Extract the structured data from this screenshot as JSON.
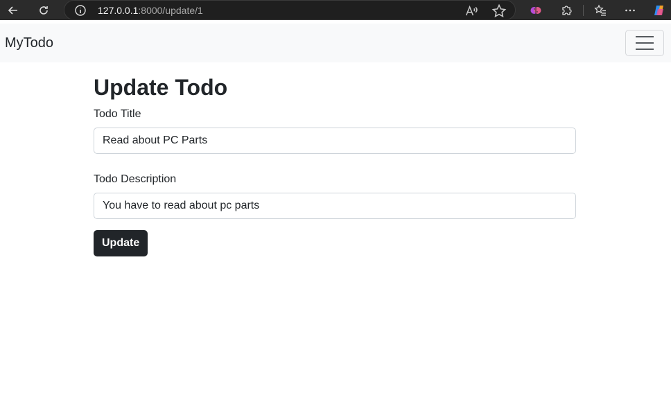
{
  "browser": {
    "url_host": "127.0.0.1",
    "url_rest": ":8000/update/1",
    "icons": [
      "back-arrow-icon",
      "refresh-icon",
      "info-icon",
      "read-aloud-icon",
      "favorite-star-icon",
      "copilot-brain-icon",
      "extensions-icon",
      "favorites-icon",
      "more-icon",
      "copilot-icon"
    ]
  },
  "navbar": {
    "brand": "MyTodo"
  },
  "main": {
    "title": "Update Todo",
    "title_label": "Todo Title",
    "title_value": "Read about PC Parts",
    "desc_label": "Todo Description",
    "desc_value": "You have to read about pc parts",
    "update_label": "Update"
  },
  "colors": {
    "navbar_bg": "#f8f9fa",
    "button_bg": "#212529",
    "chrome_bg": "#2b2b2b"
  }
}
